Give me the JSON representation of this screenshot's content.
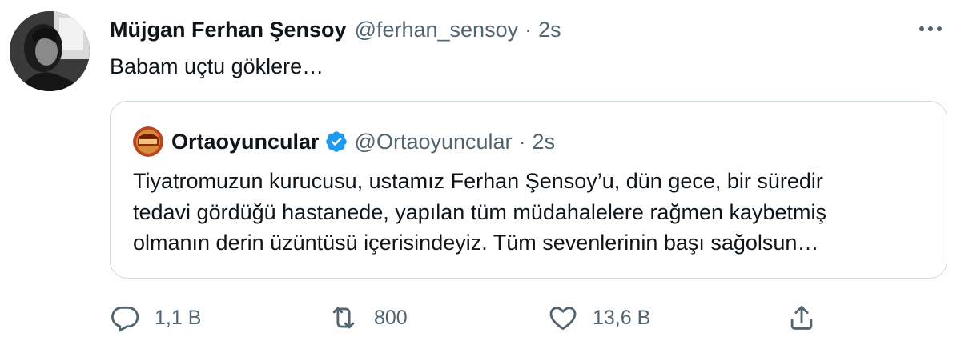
{
  "tweet": {
    "author_name": "Müjgan Ferhan Şensoy",
    "author_handle": "@ferhan_sensoy",
    "separator": "·",
    "time": "2s",
    "text": "Babam uçtu göklere…",
    "more_icon": "more-horizontal-icon"
  },
  "quoted_tweet": {
    "author_name": "Ortaoyuncular",
    "verified": true,
    "verified_color": "#1d9bf0",
    "author_handle": "@Ortaoyuncular",
    "separator": "·",
    "time": "2s",
    "text_lines": [
      "Tiyatromuzun kurucusu, ustamız Ferhan Şensoy’u, dün gece, bir süredir",
      "tedavi gördüğü hastanede, yapılan tüm müdahalelere rağmen kaybetmiş",
      "olmanın derin üzüntüsü içerisindeyiz. Tüm sevenlerinin başı sağolsun…"
    ]
  },
  "actions": {
    "reply": {
      "icon": "reply-icon",
      "count": "1,1 B"
    },
    "retweet": {
      "icon": "retweet-icon",
      "count": "800"
    },
    "like": {
      "icon": "heart-icon",
      "count": "13,6 B"
    },
    "share": {
      "icon": "share-icon"
    }
  },
  "colors": {
    "text_primary": "#0f1419",
    "text_secondary": "#536471",
    "border": "#cfd9de"
  }
}
